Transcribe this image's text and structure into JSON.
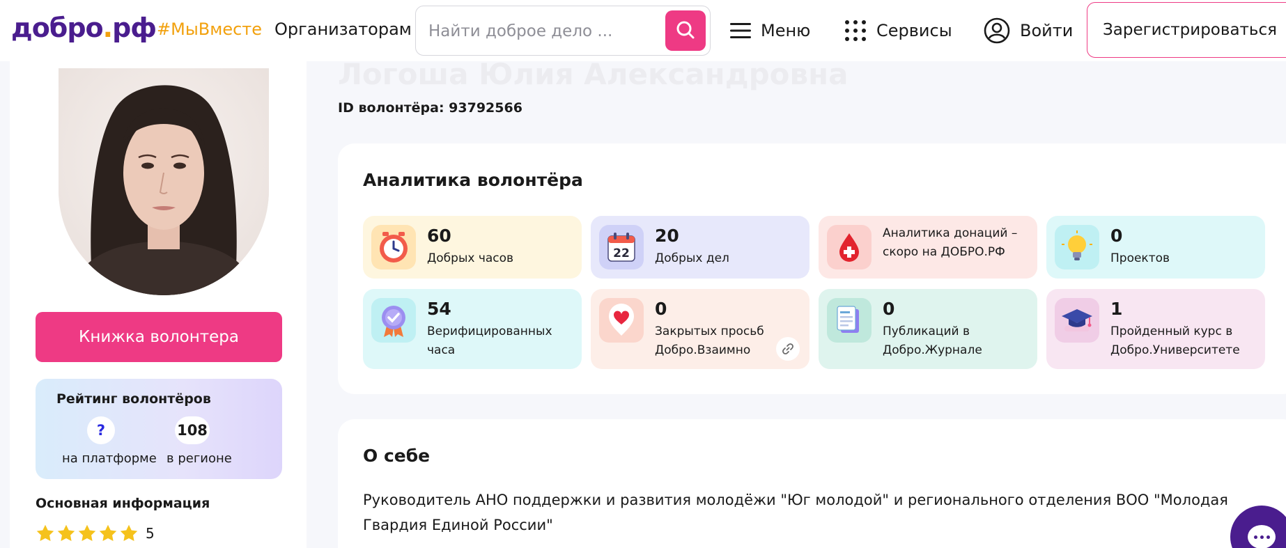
{
  "header": {
    "logo": {
      "main": "добро",
      "dot": ".",
      "tld": "рф"
    },
    "hashtag": "#МыВместе",
    "organizers": "Организаторам",
    "search": {
      "placeholder": "Найти доброе дело ..."
    },
    "menu": "Меню",
    "services": "Сервисы",
    "login": "Войти",
    "register": "Зарегистрироваться"
  },
  "sidebar": {
    "book_button": "Книжка волонтера",
    "rating": {
      "title": "Рейтинг волонтёров",
      "platform_value": "?",
      "platform_label": "на платформе",
      "region_value": "108",
      "region_label": "в регионе"
    },
    "basic_info": "Основная информация",
    "stars": {
      "rating": 5,
      "count": "5"
    }
  },
  "profile": {
    "name": "Логоша Юлия Александровна",
    "id_label": "ID волонтёра: 93792566"
  },
  "analytics": {
    "title": "Аналитика волонтёра",
    "tiles": [
      {
        "value": "60",
        "label1": "Добрых часов",
        "label2": "",
        "icon": "clock-icon",
        "bg": "#fef6df",
        "iconbg": "#ffe4b3"
      },
      {
        "value": "20",
        "label1": "Добрых дел",
        "label2": "",
        "icon": "calendar-icon",
        "bg": "#e7e8fb",
        "iconbg": "#cfd1f7"
      },
      {
        "value": "",
        "label1": "Аналитика донаций –",
        "label2": "скоро на ДОБРО.РФ",
        "icon": "blood-drop-icon",
        "bg": "#fde8e6",
        "iconbg": "#fbd0cd"
      },
      {
        "value": "0",
        "label1": "Проектов",
        "label2": "",
        "icon": "lightbulb-icon",
        "bg": "#def8f9",
        "iconbg": "#bff0f3"
      },
      {
        "value": "54",
        "label1": "Верифицированных",
        "label2": "часа",
        "icon": "verified-badge-icon",
        "bg": "#def8f9",
        "iconbg": "#bff0f3"
      },
      {
        "value": "0",
        "label1": "Закрытых просьб",
        "label2": "Добро.Взаимно",
        "icon": "heart-pin-icon",
        "bg": "#fdeee8",
        "iconbg": "#fbd6cc"
      },
      {
        "value": "0",
        "label1": "Публикаций в",
        "label2": "Добро.Журнале",
        "icon": "document-icon",
        "bg": "#dff4ee",
        "iconbg": "#bfe8dc"
      },
      {
        "value": "1",
        "label1": "Пройденный курс в",
        "label2": "Добро.Университете",
        "icon": "graduation-cap-icon",
        "bg": "#f8e6f2",
        "iconbg": "#f0cde6"
      }
    ]
  },
  "about": {
    "title": "О себе",
    "text": "Руководитель АНО поддержки и развития молодёжи \"Юг молодой\" и регионального отделения ВОО \"Молодая Гвардия Единой России\""
  },
  "colors": {
    "brand_pink": "#ee3a84",
    "brand_purple": "#4a1d8e",
    "accent_orange": "#f2a10e"
  }
}
